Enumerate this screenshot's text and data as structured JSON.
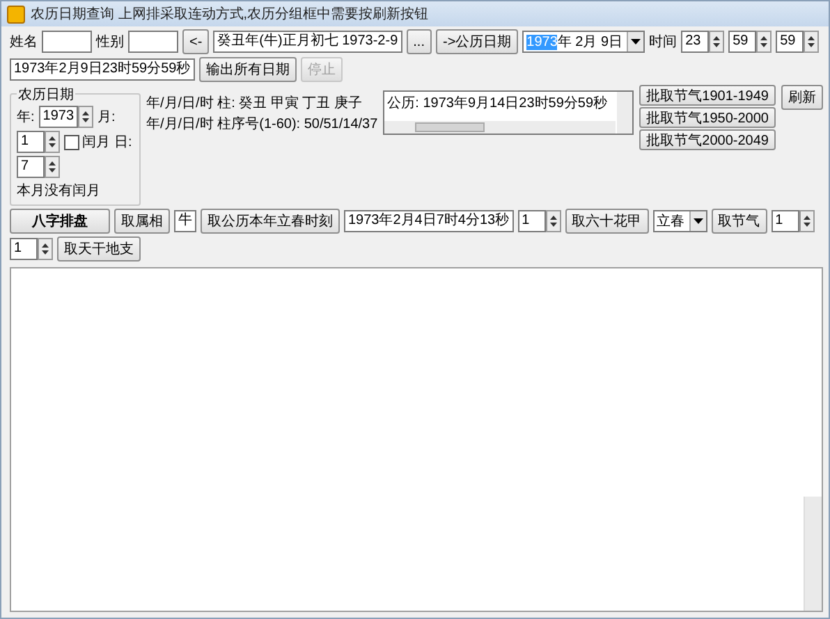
{
  "window": {
    "title": "农历日期查询 上网排采取连动方式,农历分组框中需要按刷新按钮"
  },
  "row1": [
    {
      "kind": "label",
      "text": "姓名"
    },
    {
      "kind": "input"
    },
    {
      "kind": "label",
      "text": "性别"
    },
    {
      "kind": "input"
    },
    {
      "kind": "button",
      "text": "<-"
    },
    {
      "kind": "input",
      "value": "癸丑年(牛)正月初七 1973-2-9"
    },
    {
      "kind": "button",
      "text": "..."
    },
    {
      "kind": "button",
      "text": "->公历日期"
    },
    {
      "kind": "combo",
      "selected_text": "1973",
      "value": "年 2月 9日"
    },
    {
      "kind": "label",
      "text": "时间"
    },
    {
      "kind": "spin",
      "value": "23"
    },
    {
      "kind": "spin",
      "value": "59"
    },
    {
      "kind": "spin",
      "value": "59"
    },
    {
      "kind": "input",
      "value": "1973年2月9日23时59分59秒"
    },
    {
      "kind": "button",
      "text": "输出所有日期",
      "disabled": false
    },
    {
      "kind": "button",
      "text": "停止",
      "disabled": true
    }
  ],
  "group": {
    "title": "农历日期",
    "items": [
      {
        "kind": "label",
        "text": "年:"
      },
      {
        "kind": "spin",
        "value": "1973"
      },
      {
        "kind": "label",
        "text": "月:"
      },
      {
        "kind": "spin",
        "value": "1"
      },
      {
        "kind": "check",
        "text": "闰月",
        "checked": false
      },
      {
        "kind": "label",
        "text": "日:"
      },
      {
        "kind": "spin",
        "value": "7"
      },
      {
        "kind": "label",
        "text": "本月没有闰月"
      }
    ]
  },
  "pillars": [
    "年/月/日/时 柱: 癸丑 甲寅 丁丑 庚子",
    "年/月/日/时 柱序号(1-60): 50/51/14/37"
  ],
  "solar_memo": {
    "text": "公历: 1973年9月14日23时59分59秒"
  },
  "jieqi_buttons": [
    "批取节气1901-1949",
    "批取节气1950-2000",
    "批取节气2000-2049"
  ],
  "refresh_button": "刷新",
  "row3": [
    {
      "kind": "button",
      "text": "八字排盘"
    },
    {
      "kind": "button",
      "text": "取属相"
    },
    {
      "kind": "input",
      "value": "牛"
    },
    {
      "kind": "button",
      "text": "取公历本年立春时刻"
    },
    {
      "kind": "input",
      "value": "1973年2月4日7时4分13秒"
    },
    {
      "kind": "spin",
      "value": "1"
    },
    {
      "kind": "button",
      "text": "取六十花甲"
    },
    {
      "kind": "combo",
      "value": "立春"
    },
    {
      "kind": "button",
      "text": "取节气"
    },
    {
      "kind": "spin",
      "value": "1"
    },
    {
      "kind": "spin",
      "value": "1"
    },
    {
      "kind": "button",
      "text": "取天干地支"
    }
  ]
}
